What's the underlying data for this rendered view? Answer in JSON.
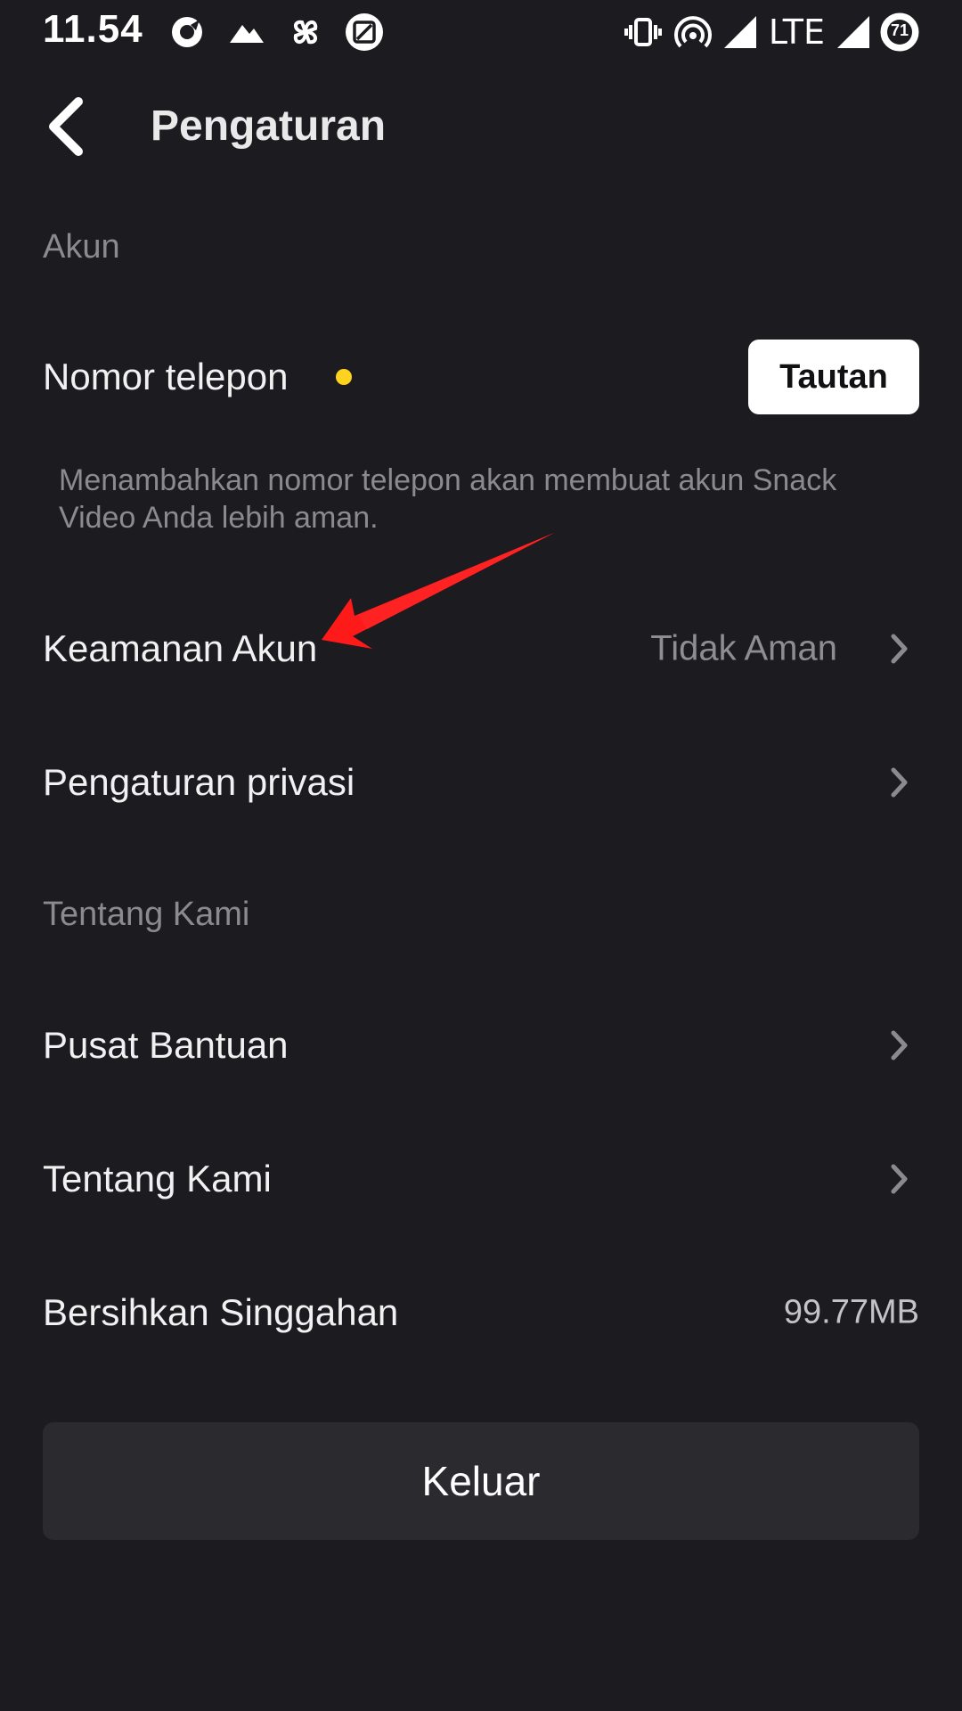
{
  "status_bar": {
    "time": "11.54",
    "network": "LTE",
    "battery_level": "71",
    "left_icons": [
      "app-notification-icon",
      "mountain-icon",
      "pinwheel-icon",
      "screenshot-icon"
    ],
    "right_icons": [
      "vibrate-icon",
      "hotspot-icon",
      "signal-icon",
      "signal-icon",
      "battery-icon"
    ]
  },
  "header": {
    "back_icon": "back-arrow-icon",
    "title": "Pengaturan"
  },
  "sections": {
    "account_label": "Akun",
    "about_label": "Tentang Kami"
  },
  "phone": {
    "label": "Nomor telepon",
    "link_button": "Tautan",
    "hint": "Menambahkan nomor telepon akan membuat akun Snack Video Anda lebih aman.",
    "dot_color": "#ffd21f"
  },
  "rows": {
    "security": {
      "label": "Keamanan Akun",
      "value": "Tidak Aman"
    },
    "privacy": {
      "label": "Pengaturan privasi"
    },
    "help": {
      "label": "Pusat Bantuan"
    },
    "about": {
      "label": "Tentang Kami"
    },
    "cache": {
      "label": "Bersihkan Singgahan",
      "value": "99.77MB"
    }
  },
  "logout": {
    "label": "Keluar"
  },
  "colors": {
    "background": "#1b1b20",
    "annotation_arrow": "#ff0000",
    "logout_background": "#2a2a2f"
  }
}
